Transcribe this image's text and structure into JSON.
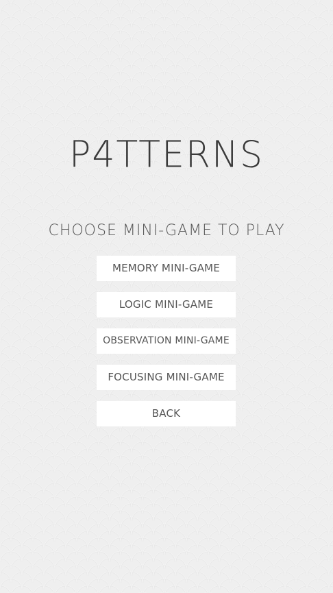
{
  "game": {
    "title": "P4TTERNS",
    "subtitle": "CHOOSE MINI-GAME TO PLAY"
  },
  "menu": {
    "buttons": [
      {
        "label": "MEMORY MINI-GAME"
      },
      {
        "label": "LOGIC MINI-GAME"
      },
      {
        "label": "OBSERVATION MINI-GAME"
      },
      {
        "label": "FOCUSING MINI-GAME"
      },
      {
        "label": "BACK"
      }
    ]
  },
  "colors": {
    "background": "#efefef",
    "button_bg": "#ffffff",
    "text": "#555555",
    "title": "#3a3a3a"
  }
}
